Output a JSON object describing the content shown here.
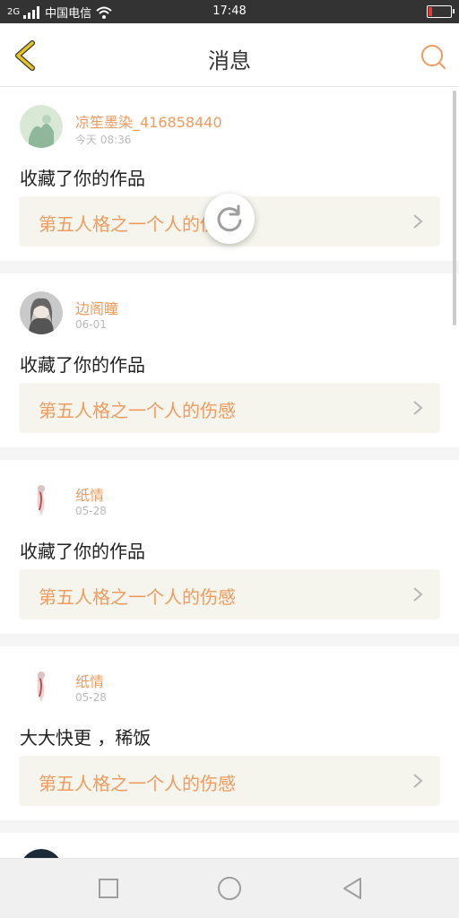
{
  "status_bar": {
    "signal_label": "2G",
    "carrier": "中国电信",
    "time": "17:48",
    "battery_percent": 15,
    "battery_color": "#e53935"
  },
  "header": {
    "title": "消息",
    "back_icon": "chevron-left-icon",
    "search_icon": "search-icon"
  },
  "messages": [
    {
      "user": "凉笙墨染_416858440",
      "time": "今天 08:36",
      "action": "收藏了你的作品",
      "work_title": "第五人格之一个人的伤感"
    },
    {
      "user": "边阁瞳",
      "time": "06-01",
      "action": "收藏了你的作品",
      "work_title": "第五人格之一个人的伤感"
    },
    {
      "user": "纸情",
      "time": "05-28",
      "action": "收藏了你的作品",
      "work_title": "第五人格之一个人的伤感"
    },
    {
      "user": "纸情",
      "time": "05-28",
      "action": "大大快更 ，稀饭",
      "work_title": "第五人格之一个人的伤感"
    }
  ],
  "colors": {
    "accent": "#f19a5e",
    "back_icon": "#e6c320",
    "card_link_bg": "#f5f5ee"
  }
}
